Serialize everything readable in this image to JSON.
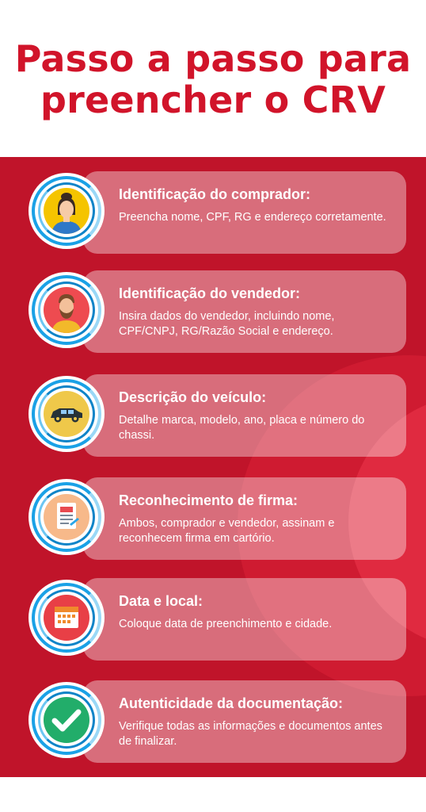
{
  "header": {
    "title_line1": "Passo a passo para",
    "title_line2": "preencher o CRV"
  },
  "colors": {
    "brand_red": "#d1142a",
    "panel_red": "#c0142a",
    "ring_blue": "#1aa1e6"
  },
  "steps": [
    {
      "title": "Identificação do comprador:",
      "desc": "Preencha nome, CPF, RG e endereço corretamente.",
      "icon": "buyer-avatar-icon"
    },
    {
      "title": "Identificação do vendedor:",
      "desc": "Insira dados do vendedor, incluindo nome, CPF/CNPJ, RG/Razão Social e endereço.",
      "icon": "seller-avatar-icon"
    },
    {
      "title": "Descrição do veículo:",
      "desc": "Detalhe marca, modelo, ano, placa e número do chassi.",
      "icon": "vehicle-icon"
    },
    {
      "title": "Reconhecimento de firma:",
      "desc": "Ambos, comprador e vendedor, assinam e reconhecem firma em cartório.",
      "icon": "document-icon"
    },
    {
      "title": "Data e local:",
      "desc": "Coloque data de preenchimento e cidade.",
      "icon": "calendar-icon"
    },
    {
      "title": "Autenticidade da documentação:",
      "desc": "Verifique todas as informações e documentos antes de finalizar.",
      "icon": "checkmark-icon"
    }
  ]
}
